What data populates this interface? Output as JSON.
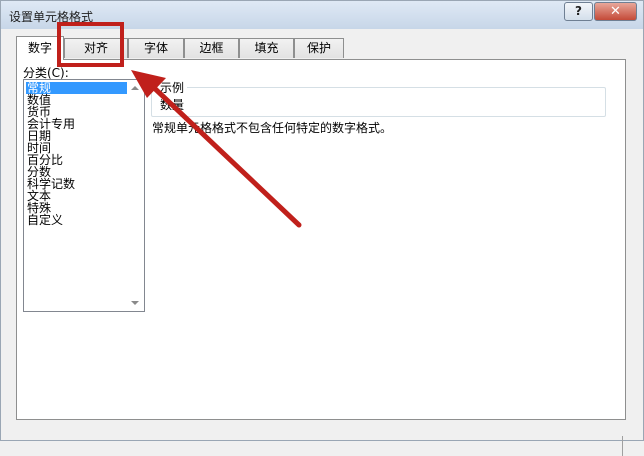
{
  "window": {
    "title": "设置单元格格式",
    "help_label": "?",
    "close_label": "✕"
  },
  "tabs": [
    {
      "label": "数字",
      "active": true
    },
    {
      "label": "对齐",
      "active": false
    },
    {
      "label": "字体",
      "active": false
    },
    {
      "label": "边框",
      "active": false
    },
    {
      "label": "填充",
      "active": false
    },
    {
      "label": "保护",
      "active": false
    }
  ],
  "category": {
    "label": "分类(C):",
    "items": [
      "常规",
      "数值",
      "货币",
      "会计专用",
      "日期",
      "时间",
      "百分比",
      "分数",
      "科学记数",
      "文本",
      "特殊",
      "自定义"
    ],
    "selected": "常规"
  },
  "sample": {
    "legend": "示例",
    "value": "数量"
  },
  "description": "常规单元格格式不包含任何特定的数字格式。",
  "colors": {
    "selection": "#3399ff",
    "annotation": "#c0201b"
  },
  "icons": {
    "scroll_up": "chevron-up-icon",
    "scroll_down": "chevron-down-icon",
    "pointer": "red-arrow-annotation"
  }
}
